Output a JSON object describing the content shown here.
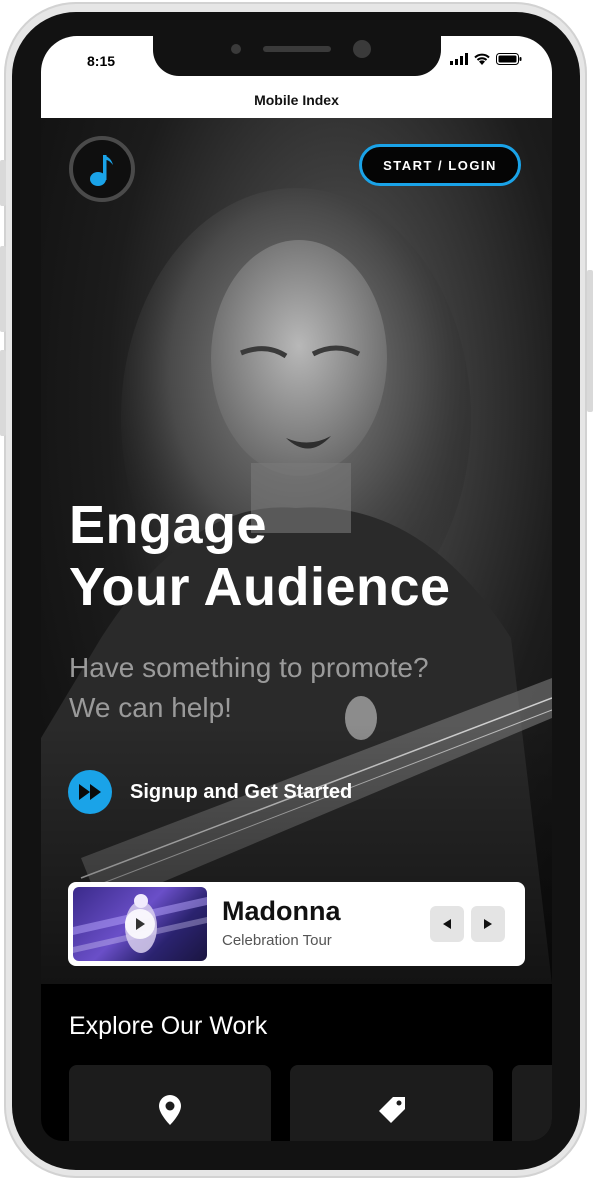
{
  "status_bar": {
    "time": "8:15"
  },
  "window": {
    "title": "Mobile Index"
  },
  "header": {
    "cta_label": "START / LOGIN",
    "logo_icon": "music-note-icon"
  },
  "hero": {
    "headline_line1": "Engage",
    "headline_line2": "Your Audience",
    "subhead_line1": "Have something to promote?",
    "subhead_line2": "We can help!",
    "signup_label": "Signup and Get Started"
  },
  "featured": {
    "title": "Madonna",
    "subtitle": "Celebration Tour"
  },
  "explore": {
    "title": "Explore Our Work",
    "tiles": [
      {
        "icon": "map-pin-icon"
      },
      {
        "icon": "tag-icon"
      },
      {
        "icon": ""
      }
    ]
  },
  "colors": {
    "accent": "#1aa3e8",
    "background": "#000000",
    "card": "#ffffff"
  }
}
